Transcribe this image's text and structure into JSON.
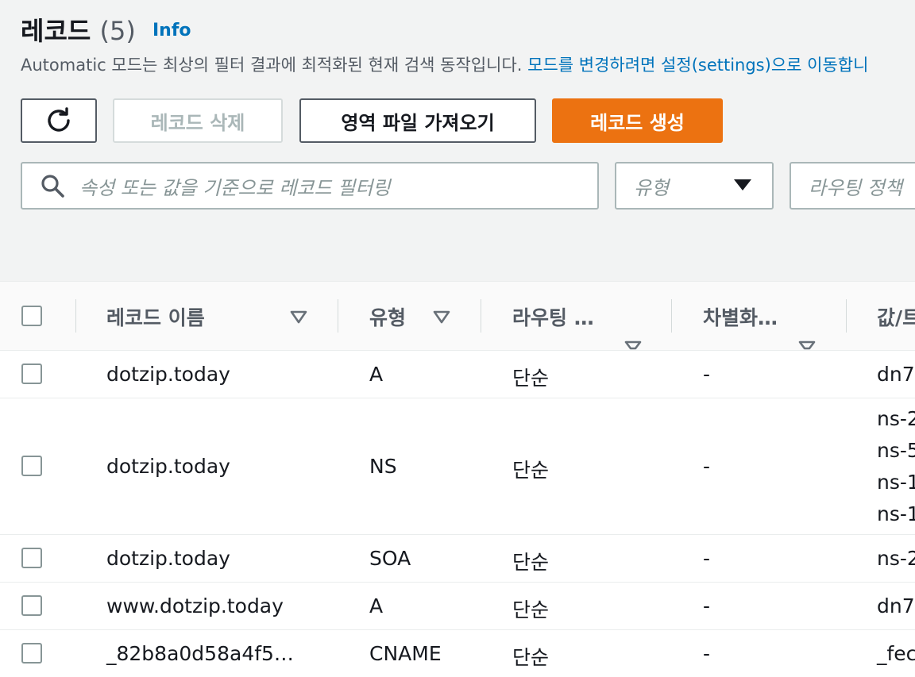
{
  "header": {
    "title": "레코드",
    "count": "(5)",
    "info": "Info",
    "description": "Automatic 모드는 최상의 필터 결과에 최적화된 현재 검색 동작입니다.",
    "description_link": "모드를 변경하려면 설정(settings)으로 이동합니"
  },
  "toolbar": {
    "refresh_icon": "refresh-icon",
    "delete_label": "레코드 삭제",
    "import_label": "영역 파일 가져오기",
    "create_label": "레코드 생성"
  },
  "filters": {
    "search_placeholder": "속성 또는 값을 기준으로 레코드 필터링",
    "type_placeholder": "유형",
    "routing_placeholder": "라우팅 정책"
  },
  "table": {
    "columns": [
      "레코드 이름",
      "유형",
      "라우팅 …",
      "차별화…",
      "값/트"
    ],
    "rows": [
      {
        "name": "dotzip.today",
        "type": "A",
        "routing": "단순",
        "diff": "-",
        "values": [
          "dn7"
        ]
      },
      {
        "name": "dotzip.today",
        "type": "NS",
        "routing": "단순",
        "diff": "-",
        "values": [
          "ns-2",
          "ns-5",
          "ns-1",
          "ns-1"
        ]
      },
      {
        "name": "dotzip.today",
        "type": "SOA",
        "routing": "단순",
        "diff": "-",
        "values": [
          "ns-2"
        ]
      },
      {
        "name": "www.dotzip.today",
        "type": "A",
        "routing": "단순",
        "diff": "-",
        "values": [
          "dn7"
        ]
      },
      {
        "name": "_82b8a0d58a4f5…",
        "type": "CNAME",
        "routing": "단순",
        "diff": "-",
        "values": [
          "_fec"
        ]
      }
    ]
  },
  "colors": {
    "primary": "#ec7211",
    "link": "#0073bb"
  }
}
